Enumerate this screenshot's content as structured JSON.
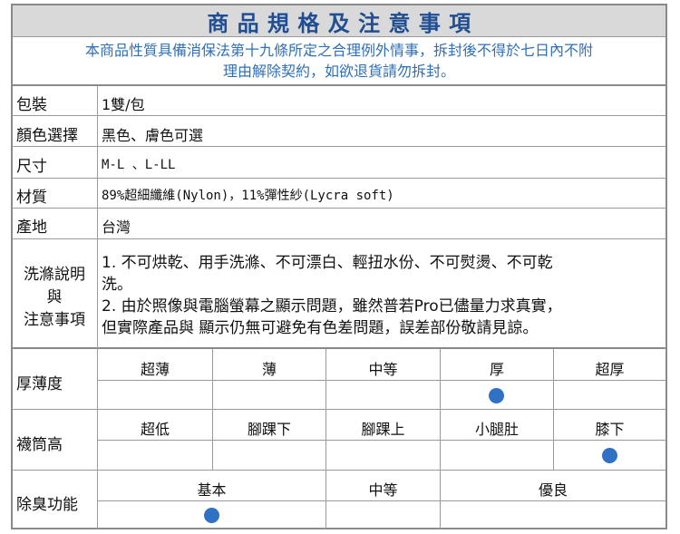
{
  "title": "商 品 規 格 及 注 意 事 項",
  "notice": {
    "line1": "本商品性質具備消保法第十九條所定之合理例外情事，拆封後不得於七日內不附",
    "line2": "理由解除契約，如欲退貨請勿拆封。"
  },
  "specs": [
    {
      "label": "包裝",
      "value": "1雙/包"
    },
    {
      "label": "顏色選擇",
      "value": "黑色、膚色可選"
    },
    {
      "label": "尺寸",
      "value": "M-L 、L-LL"
    },
    {
      "label": "材質",
      "value": "89%超細纖維(Nylon)，11%彈性紗(Lycra soft)"
    },
    {
      "label": "產地",
      "value": "台灣"
    }
  ],
  "care": {
    "label_line1": "洗滌說明",
    "label_line2": "與",
    "label_line3": "注意事項",
    "line1": "1. 不可烘乾、用手洗滌、不可漂白、輕扭水份、不可熨燙、不可乾",
    "line2": "洗。",
    "line3": "2. 由於照像與電腦螢幕之顯示問題，雖然普若Pro已儘量力求真實，",
    "line4": "但實際產品與 顯示仍無可避免有色差問題，誤差部份敬請見諒。"
  },
  "ratings": {
    "thickness": {
      "label": "厚薄度",
      "options": [
        "超薄",
        "薄",
        "中等",
        "厚",
        "超厚"
      ],
      "selected": "厚"
    },
    "sock_height": {
      "label": "襪筒高",
      "options": [
        "超低",
        "腳踝下",
        "腳踝上",
        "小腿肚",
        "膝下"
      ],
      "selected": "膝下"
    },
    "deodorant": {
      "label": "除臭功能",
      "options": [
        "基本",
        "中等",
        "優良"
      ],
      "selected": "基本"
    }
  },
  "colors": {
    "title_text": "#1f4e93",
    "notice_text": "#2f6fb5",
    "header_bg": "#d9d9d9",
    "dot": "#2f72c4",
    "border": "#8a8a8a"
  }
}
